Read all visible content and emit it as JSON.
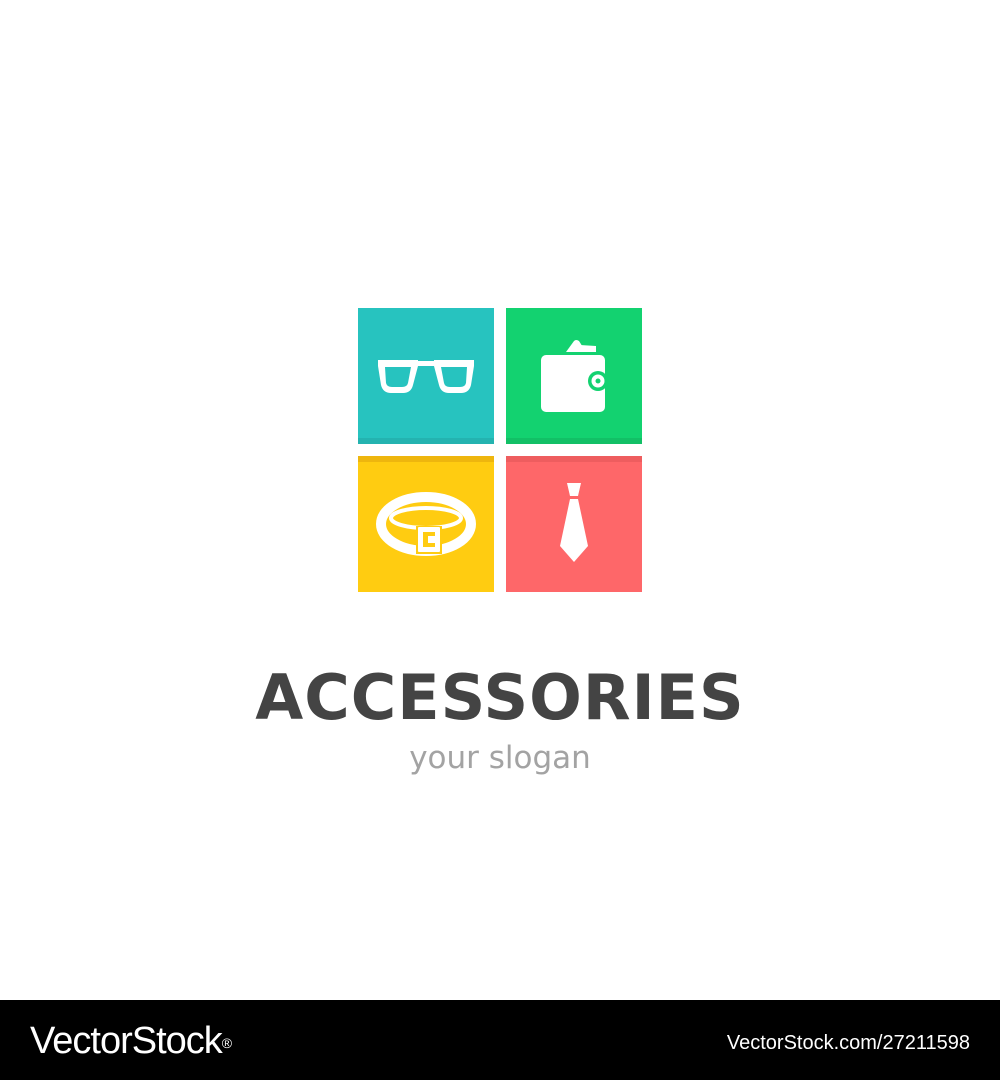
{
  "logo": {
    "tiles": [
      {
        "icon": "glasses-icon",
        "color": "#27c3bf",
        "shade": "#24b3b0"
      },
      {
        "icon": "wallet-icon",
        "color": "#13d270",
        "shade": "#12c066"
      },
      {
        "icon": "belt-icon",
        "color": "#ffcc11",
        "shade": "#eeb60e"
      },
      {
        "icon": "tie-icon",
        "color": "#fe6769",
        "shade": "#ee5d5f"
      }
    ]
  },
  "brand": {
    "name": "ACCESSORIES",
    "slogan": "your slogan",
    "name_color": "#444444",
    "slogan_color": "#a3a3a3"
  },
  "footer": {
    "brand": "VectorStock",
    "registered_mark": "®",
    "id": "VectorStock.com/27211598"
  }
}
